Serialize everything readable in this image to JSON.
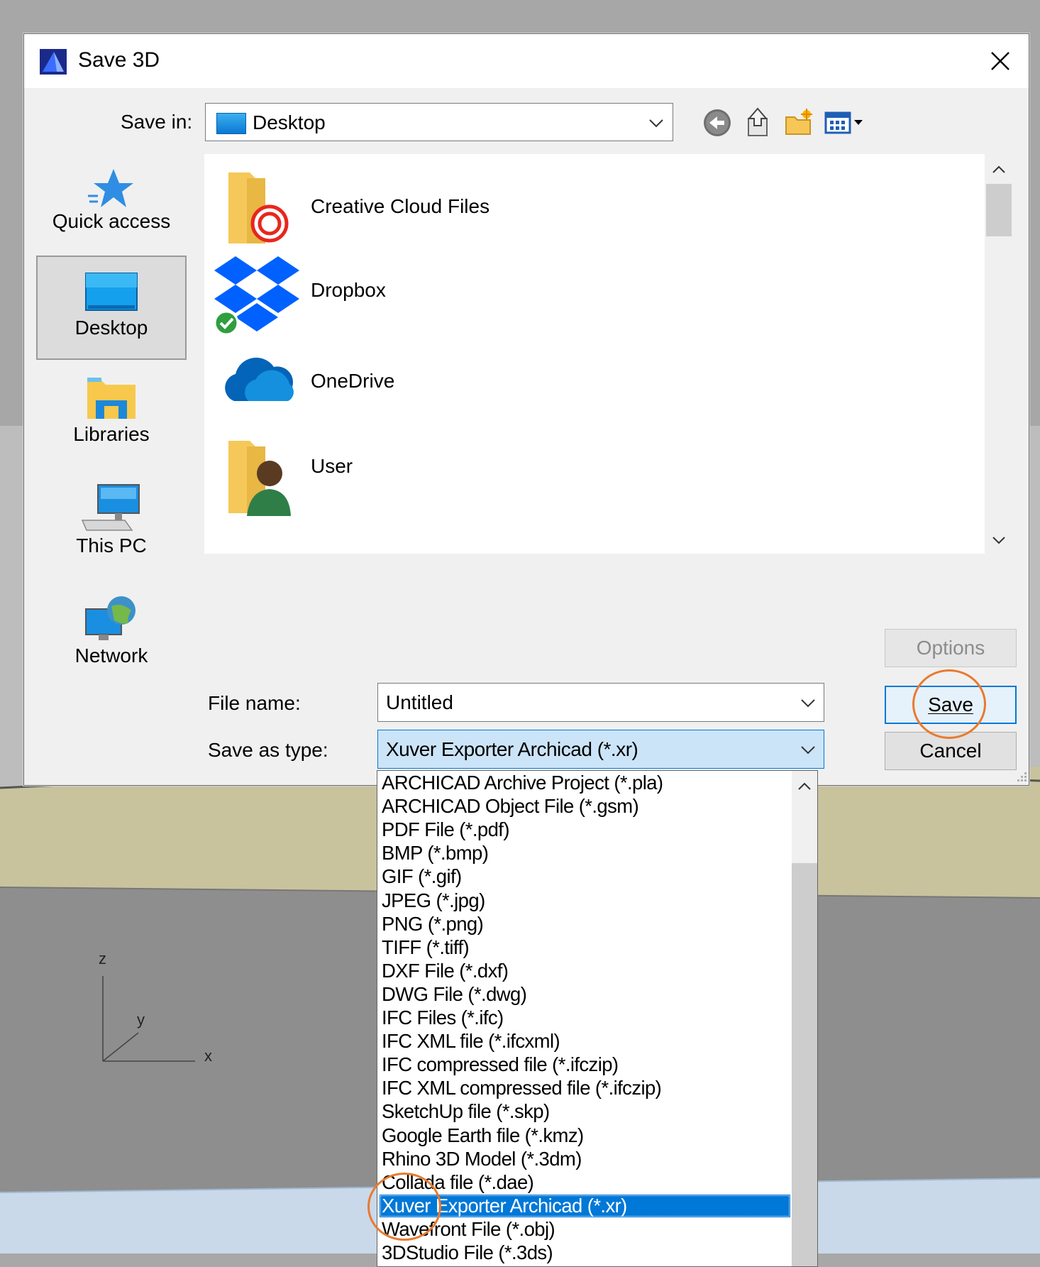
{
  "dialog": {
    "title": "Save 3D",
    "close_glyph": "✕"
  },
  "savein": {
    "label": "Save in:",
    "value": "Desktop"
  },
  "toolbar": {
    "icons": [
      "back-icon",
      "up-folder-icon",
      "new-folder-icon",
      "view-menu-icon"
    ]
  },
  "places": [
    {
      "label": "Quick access",
      "icon": "quick-access-icon"
    },
    {
      "label": "Desktop",
      "icon": "desktop-icon",
      "selected": true
    },
    {
      "label": "Libraries",
      "icon": "libraries-icon"
    },
    {
      "label": "This PC",
      "icon": "this-pc-icon"
    },
    {
      "label": "Network",
      "icon": "network-icon"
    }
  ],
  "files": [
    {
      "name": "Creative Cloud Files",
      "icon": "creative-cloud-folder-icon"
    },
    {
      "name": "Dropbox",
      "icon": "dropbox-icon"
    },
    {
      "name": "OneDrive",
      "icon": "onedrive-icon"
    },
    {
      "name": "User",
      "icon": "user-folder-icon"
    }
  ],
  "form": {
    "filename_label": "File name:",
    "filename_value": "Untitled",
    "type_label": "Save as type:",
    "type_value": "Xuver Exporter Archicad (*.xr)"
  },
  "buttons": {
    "options": "Options",
    "save": "Save",
    "cancel": "Cancel"
  },
  "type_options": [
    "ARCHICAD Archive Project (*.pla)",
    "ARCHICAD Object File (*.gsm)",
    "PDF File (*.pdf)",
    "BMP (*.bmp)",
    "GIF (*.gif)",
    "JPEG (*.jpg)",
    "PNG (*.png)",
    "TIFF (*.tiff)",
    "DXF File (*.dxf)",
    "DWG File (*.dwg)",
    "IFC Files (*.ifc)",
    "IFC XML file (*.ifcxml)",
    "IFC compressed file (*.ifczip)",
    "IFC XML compressed file (*.ifczip)",
    "SketchUp file (*.skp)",
    "Google Earth file (*.kmz)",
    "Rhino 3D Model (*.3dm)",
    "Collada file (*.dae)",
    "Xuver Exporter Archicad (*.xr)",
    "Wavefront File (*.obj)",
    "3DStudio File (*.3ds)"
  ],
  "selected_type_index": 18,
  "axes": {
    "z": "z",
    "y": "y",
    "x": "x"
  },
  "colors": {
    "accent": "#0078d7",
    "highlight_circle": "#e97a2e",
    "dialog_bg": "#f0f0f0"
  }
}
